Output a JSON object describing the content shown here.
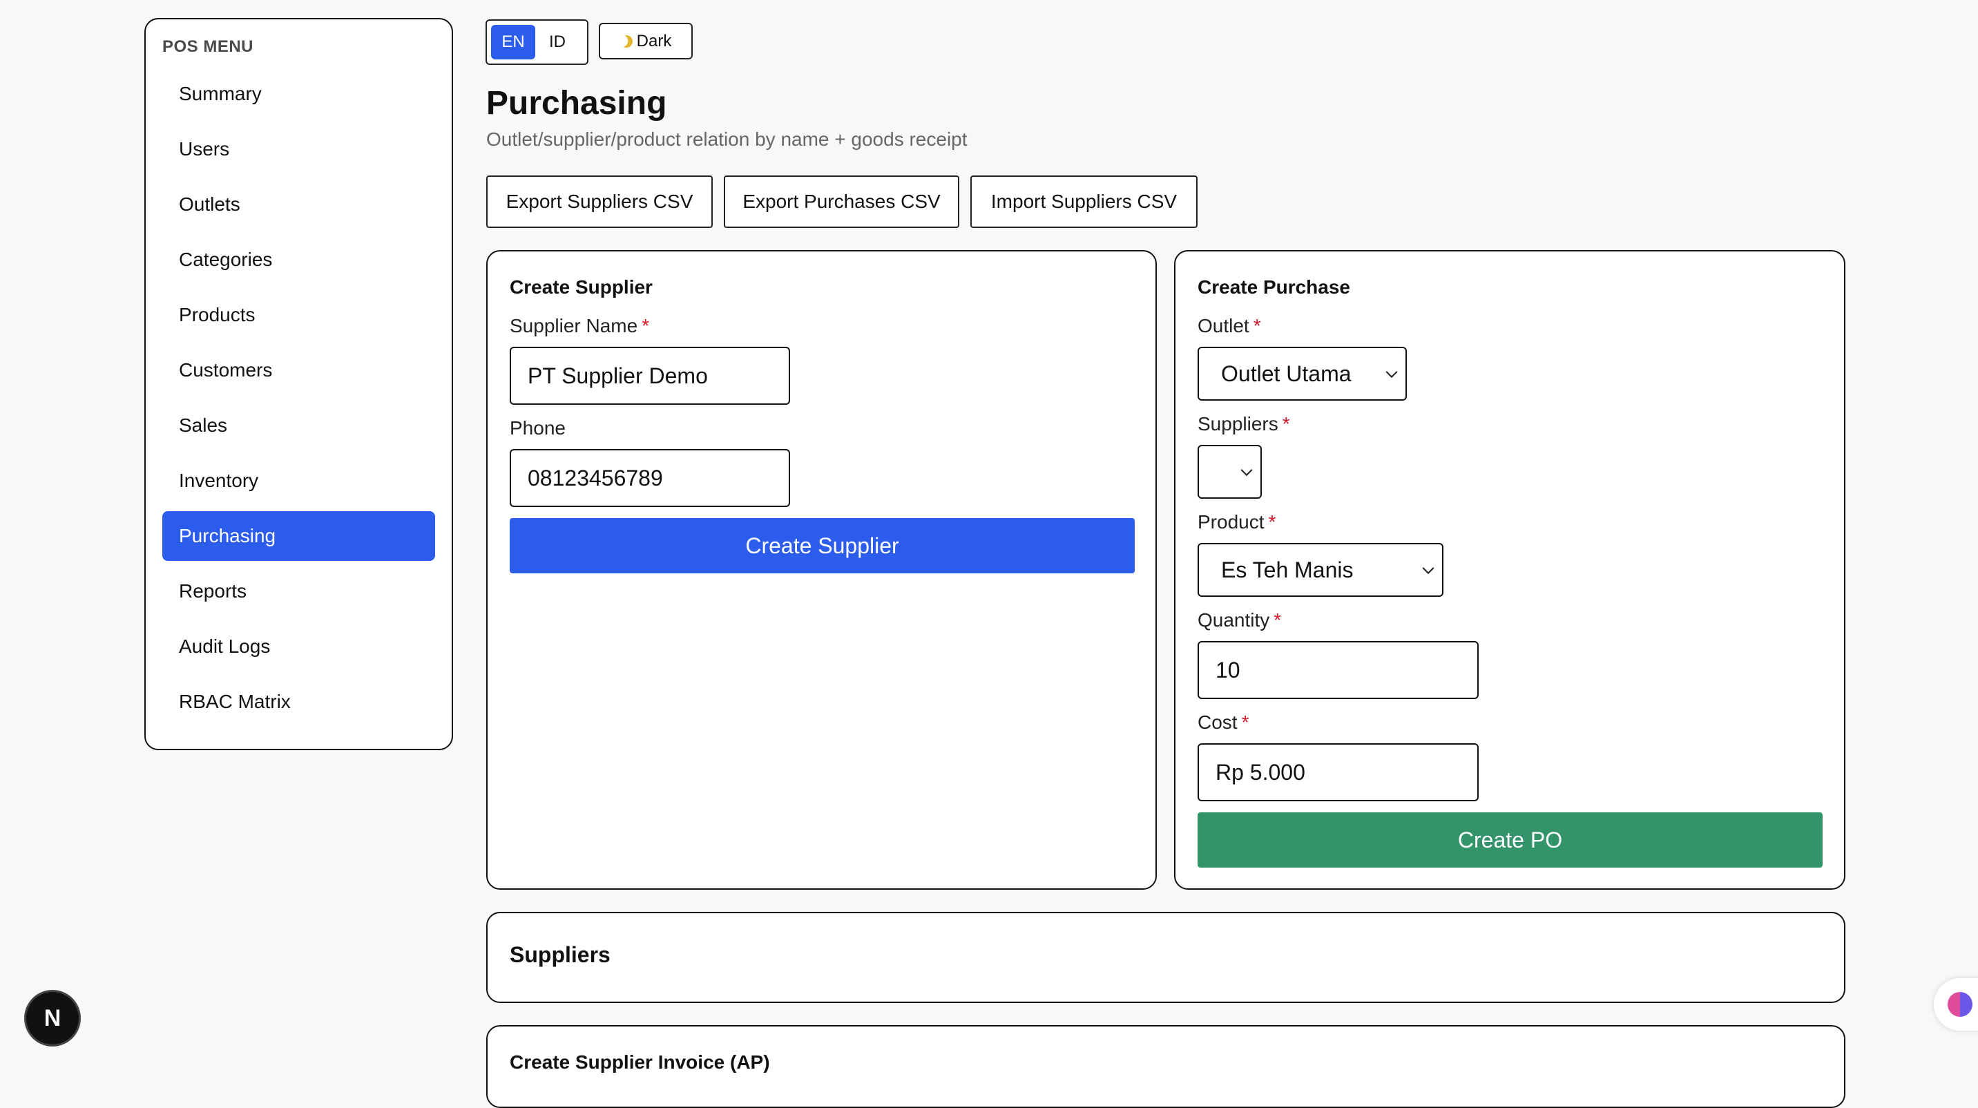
{
  "sidebar": {
    "title": "POS MENU",
    "items": [
      {
        "label": "Summary"
      },
      {
        "label": "Users"
      },
      {
        "label": "Outlets"
      },
      {
        "label": "Categories"
      },
      {
        "label": "Products"
      },
      {
        "label": "Customers"
      },
      {
        "label": "Sales"
      },
      {
        "label": "Inventory"
      },
      {
        "label": "Purchasing",
        "active": true
      },
      {
        "label": "Reports"
      },
      {
        "label": "Audit Logs"
      },
      {
        "label": "RBAC Matrix"
      }
    ]
  },
  "header": {
    "lang": {
      "en": "EN",
      "id": "ID",
      "selected": "EN"
    },
    "dark_label": "Dark",
    "dark_icon": "moon-icon",
    "title": "Purchasing",
    "subtitle": "Outlet/supplier/product relation by name + goods receipt"
  },
  "actions": {
    "export_suppliers": "Export Suppliers CSV",
    "export_purchases": "Export Purchases CSV",
    "import_suppliers": "Import Suppliers CSV"
  },
  "create_supplier": {
    "title": "Create Supplier",
    "name_label": "Supplier Name",
    "name_value": "PT Supplier Demo",
    "phone_label": "Phone",
    "phone_value": "08123456789",
    "submit_label": "Create Supplier",
    "submit_color": "#2b5ceb"
  },
  "create_purchase": {
    "title": "Create Purchase",
    "outlet_label": "Outlet",
    "outlet_value": "Outlet Utama",
    "suppliers_label": "Suppliers",
    "suppliers_value": "",
    "product_label": "Product",
    "product_value": "Es Teh Manis",
    "quantity_label": "Quantity",
    "quantity_value": "10",
    "cost_label": "Cost",
    "cost_value": "Rp 5.000",
    "submit_label": "Create PO",
    "submit_color": "#339469"
  },
  "suppliers_section": {
    "title": "Suppliers"
  },
  "invoice_section": {
    "title": "Create Supplier Invoice (AP)"
  },
  "required_marker": "*",
  "next_badge": "N"
}
